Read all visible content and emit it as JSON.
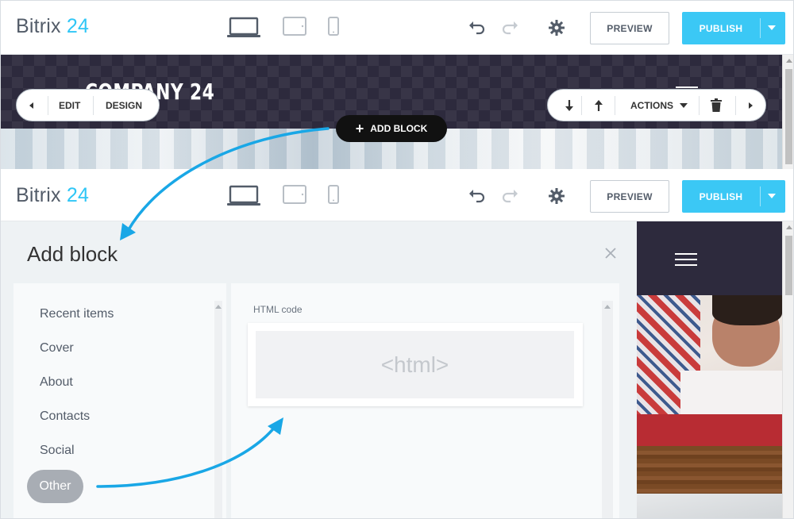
{
  "brand": {
    "name_part1": "Bitrix",
    "name_part2": " 24"
  },
  "toolbar": {
    "devices": [
      "laptop-icon",
      "tablet-icon",
      "phone-icon"
    ],
    "preview_label": "PREVIEW",
    "publish_label": "PUBLISH"
  },
  "site": {
    "company_name": "COMPANY 24"
  },
  "block_controls": {
    "edit_label": "EDIT",
    "design_label": "DESIGN",
    "add_block_label": "ADD BLOCK",
    "actions_label": "ACTIONS"
  },
  "panel": {
    "title": "Add block",
    "categories": [
      "Recent items",
      "Cover",
      "About",
      "Contacts",
      "Social",
      "Other"
    ],
    "selected_category": "Other",
    "section_label": "HTML code",
    "block_preview_text": "<html>"
  },
  "colors": {
    "accent": "#3bc8f5",
    "brand_blue": "#2fc6f6",
    "arrow": "#19a7e6",
    "dark": "#2d2a3d"
  }
}
